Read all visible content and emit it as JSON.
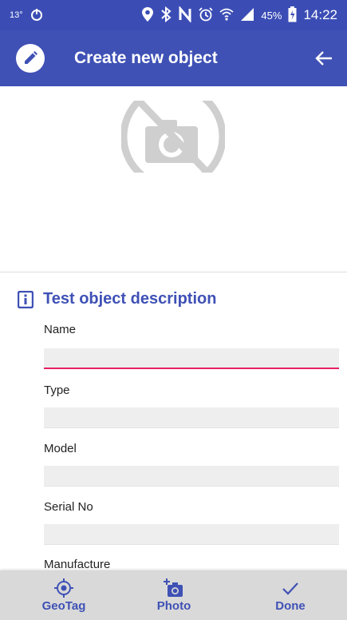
{
  "status_bar": {
    "temperature": "13°",
    "battery_percent": "45%",
    "time": "14:22",
    "icons": [
      "power-icon",
      "location-icon",
      "bluetooth-icon",
      "nfc-icon",
      "alarm-icon",
      "wifi-icon",
      "signal-icon",
      "battery-icon"
    ]
  },
  "app_bar": {
    "title": "Create new object",
    "left_icon": "edit-icon",
    "right_icon": "back-arrow-icon",
    "color": "#3f51b5"
  },
  "photo": {
    "placeholder_icon": "no-camera-icon"
  },
  "section": {
    "title": "Test object description",
    "icon": "info-icon",
    "accent_color": "#3f51b5"
  },
  "fields": {
    "name": {
      "label": "Name",
      "value": ""
    },
    "type": {
      "label": "Type",
      "value": ""
    },
    "model": {
      "label": "Model",
      "value": ""
    },
    "serial": {
      "label": "Serial No",
      "value": ""
    },
    "manufacture": {
      "label": "Manufacture",
      "value": ""
    }
  },
  "bottom_nav": {
    "geotag": {
      "label": "GeoTag",
      "icon": "location-target-icon"
    },
    "photo": {
      "label": "Photo",
      "icon": "add-photo-icon"
    },
    "done": {
      "label": "Done",
      "icon": "checkmark-icon"
    }
  }
}
